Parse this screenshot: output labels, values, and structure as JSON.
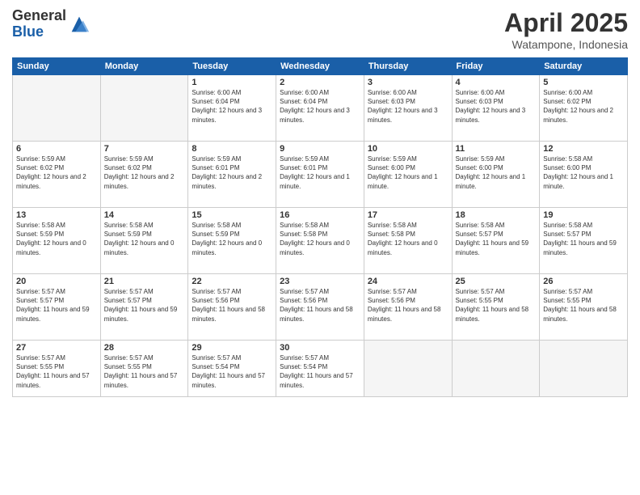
{
  "logo": {
    "general": "General",
    "blue": "Blue"
  },
  "header": {
    "title": "April 2025",
    "subtitle": "Watampone, Indonesia"
  },
  "weekdays": [
    "Sunday",
    "Monday",
    "Tuesday",
    "Wednesday",
    "Thursday",
    "Friday",
    "Saturday"
  ],
  "weeks": [
    [
      {
        "day": "",
        "info": ""
      },
      {
        "day": "",
        "info": ""
      },
      {
        "day": "1",
        "info": "Sunrise: 6:00 AM\nSunset: 6:04 PM\nDaylight: 12 hours and 3 minutes."
      },
      {
        "day": "2",
        "info": "Sunrise: 6:00 AM\nSunset: 6:04 PM\nDaylight: 12 hours and 3 minutes."
      },
      {
        "day": "3",
        "info": "Sunrise: 6:00 AM\nSunset: 6:03 PM\nDaylight: 12 hours and 3 minutes."
      },
      {
        "day": "4",
        "info": "Sunrise: 6:00 AM\nSunset: 6:03 PM\nDaylight: 12 hours and 3 minutes."
      },
      {
        "day": "5",
        "info": "Sunrise: 6:00 AM\nSunset: 6:02 PM\nDaylight: 12 hours and 2 minutes."
      }
    ],
    [
      {
        "day": "6",
        "info": "Sunrise: 5:59 AM\nSunset: 6:02 PM\nDaylight: 12 hours and 2 minutes."
      },
      {
        "day": "7",
        "info": "Sunrise: 5:59 AM\nSunset: 6:02 PM\nDaylight: 12 hours and 2 minutes."
      },
      {
        "day": "8",
        "info": "Sunrise: 5:59 AM\nSunset: 6:01 PM\nDaylight: 12 hours and 2 minutes."
      },
      {
        "day": "9",
        "info": "Sunrise: 5:59 AM\nSunset: 6:01 PM\nDaylight: 12 hours and 1 minute."
      },
      {
        "day": "10",
        "info": "Sunrise: 5:59 AM\nSunset: 6:00 PM\nDaylight: 12 hours and 1 minute."
      },
      {
        "day": "11",
        "info": "Sunrise: 5:59 AM\nSunset: 6:00 PM\nDaylight: 12 hours and 1 minute."
      },
      {
        "day": "12",
        "info": "Sunrise: 5:58 AM\nSunset: 6:00 PM\nDaylight: 12 hours and 1 minute."
      }
    ],
    [
      {
        "day": "13",
        "info": "Sunrise: 5:58 AM\nSunset: 5:59 PM\nDaylight: 12 hours and 0 minutes."
      },
      {
        "day": "14",
        "info": "Sunrise: 5:58 AM\nSunset: 5:59 PM\nDaylight: 12 hours and 0 minutes."
      },
      {
        "day": "15",
        "info": "Sunrise: 5:58 AM\nSunset: 5:59 PM\nDaylight: 12 hours and 0 minutes."
      },
      {
        "day": "16",
        "info": "Sunrise: 5:58 AM\nSunset: 5:58 PM\nDaylight: 12 hours and 0 minutes."
      },
      {
        "day": "17",
        "info": "Sunrise: 5:58 AM\nSunset: 5:58 PM\nDaylight: 12 hours and 0 minutes."
      },
      {
        "day": "18",
        "info": "Sunrise: 5:58 AM\nSunset: 5:57 PM\nDaylight: 11 hours and 59 minutes."
      },
      {
        "day": "19",
        "info": "Sunrise: 5:58 AM\nSunset: 5:57 PM\nDaylight: 11 hours and 59 minutes."
      }
    ],
    [
      {
        "day": "20",
        "info": "Sunrise: 5:57 AM\nSunset: 5:57 PM\nDaylight: 11 hours and 59 minutes."
      },
      {
        "day": "21",
        "info": "Sunrise: 5:57 AM\nSunset: 5:57 PM\nDaylight: 11 hours and 59 minutes."
      },
      {
        "day": "22",
        "info": "Sunrise: 5:57 AM\nSunset: 5:56 PM\nDaylight: 11 hours and 58 minutes."
      },
      {
        "day": "23",
        "info": "Sunrise: 5:57 AM\nSunset: 5:56 PM\nDaylight: 11 hours and 58 minutes."
      },
      {
        "day": "24",
        "info": "Sunrise: 5:57 AM\nSunset: 5:56 PM\nDaylight: 11 hours and 58 minutes."
      },
      {
        "day": "25",
        "info": "Sunrise: 5:57 AM\nSunset: 5:55 PM\nDaylight: 11 hours and 58 minutes."
      },
      {
        "day": "26",
        "info": "Sunrise: 5:57 AM\nSunset: 5:55 PM\nDaylight: 11 hours and 58 minutes."
      }
    ],
    [
      {
        "day": "27",
        "info": "Sunrise: 5:57 AM\nSunset: 5:55 PM\nDaylight: 11 hours and 57 minutes."
      },
      {
        "day": "28",
        "info": "Sunrise: 5:57 AM\nSunset: 5:55 PM\nDaylight: 11 hours and 57 minutes."
      },
      {
        "day": "29",
        "info": "Sunrise: 5:57 AM\nSunset: 5:54 PM\nDaylight: 11 hours and 57 minutes."
      },
      {
        "day": "30",
        "info": "Sunrise: 5:57 AM\nSunset: 5:54 PM\nDaylight: 11 hours and 57 minutes."
      },
      {
        "day": "",
        "info": ""
      },
      {
        "day": "",
        "info": ""
      },
      {
        "day": "",
        "info": ""
      }
    ]
  ]
}
